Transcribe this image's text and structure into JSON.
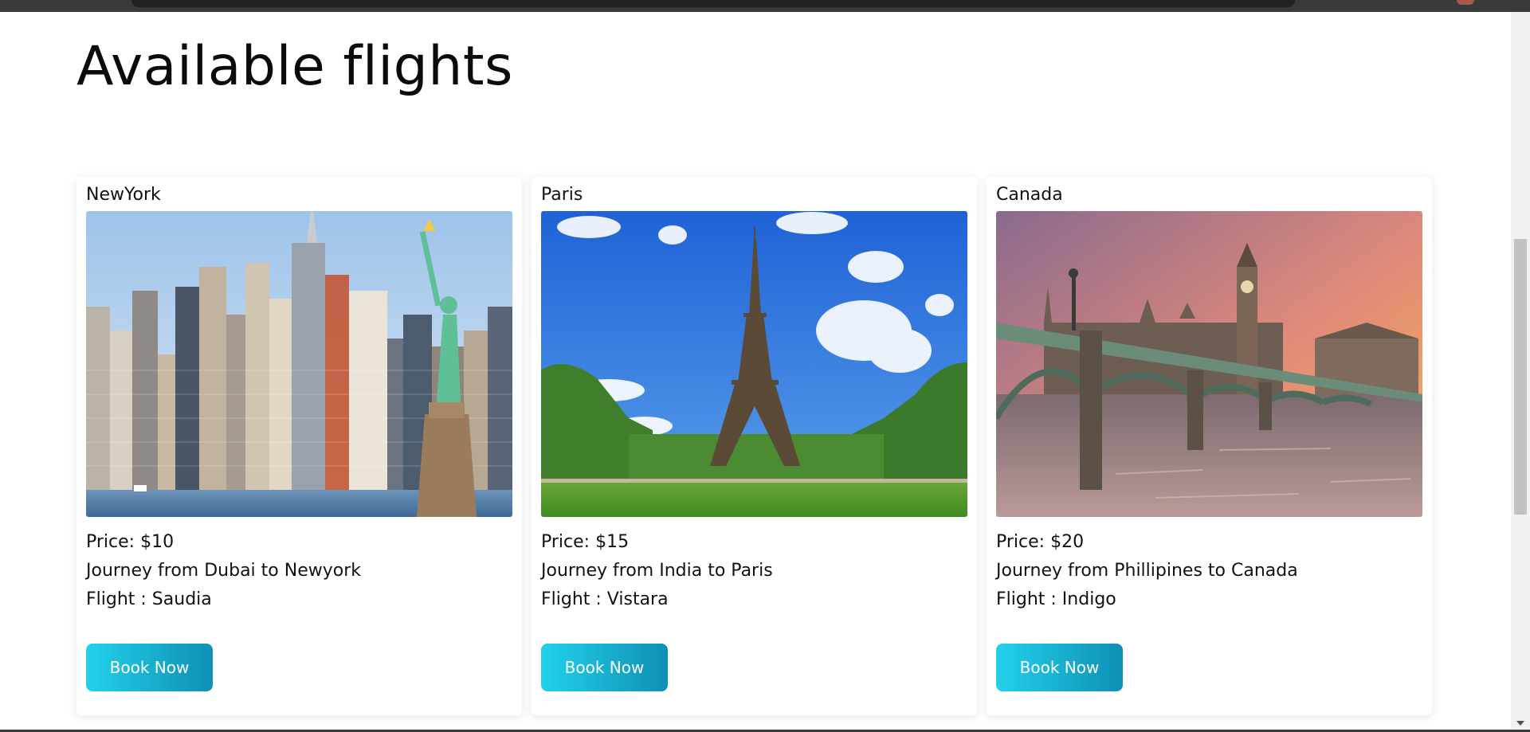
{
  "page": {
    "title": "Available flights"
  },
  "cards": [
    {
      "city": "NewYork",
      "price": "Price: $10",
      "journey": "Journey from Dubai to Newyork",
      "flight": "Flight : Saudia",
      "button": "Book Now",
      "image_icon": "new-york-skyline-photo"
    },
    {
      "city": "Paris",
      "price": "Price: $15",
      "journey": "Journey from India to Paris",
      "flight": "Flight : Vistara",
      "button": "Book Now",
      "image_icon": "eiffel-tower-photo"
    },
    {
      "city": "Canada",
      "price": "Price: $20",
      "journey": "Journey from Phillipines to Canada",
      "flight": "Flight : Indigo",
      "button": "Book Now",
      "image_icon": "westminster-bridge-photo"
    }
  ],
  "colors": {
    "button_gradient_start": "#22d1ea",
    "button_gradient_end": "#0f8fb6"
  }
}
